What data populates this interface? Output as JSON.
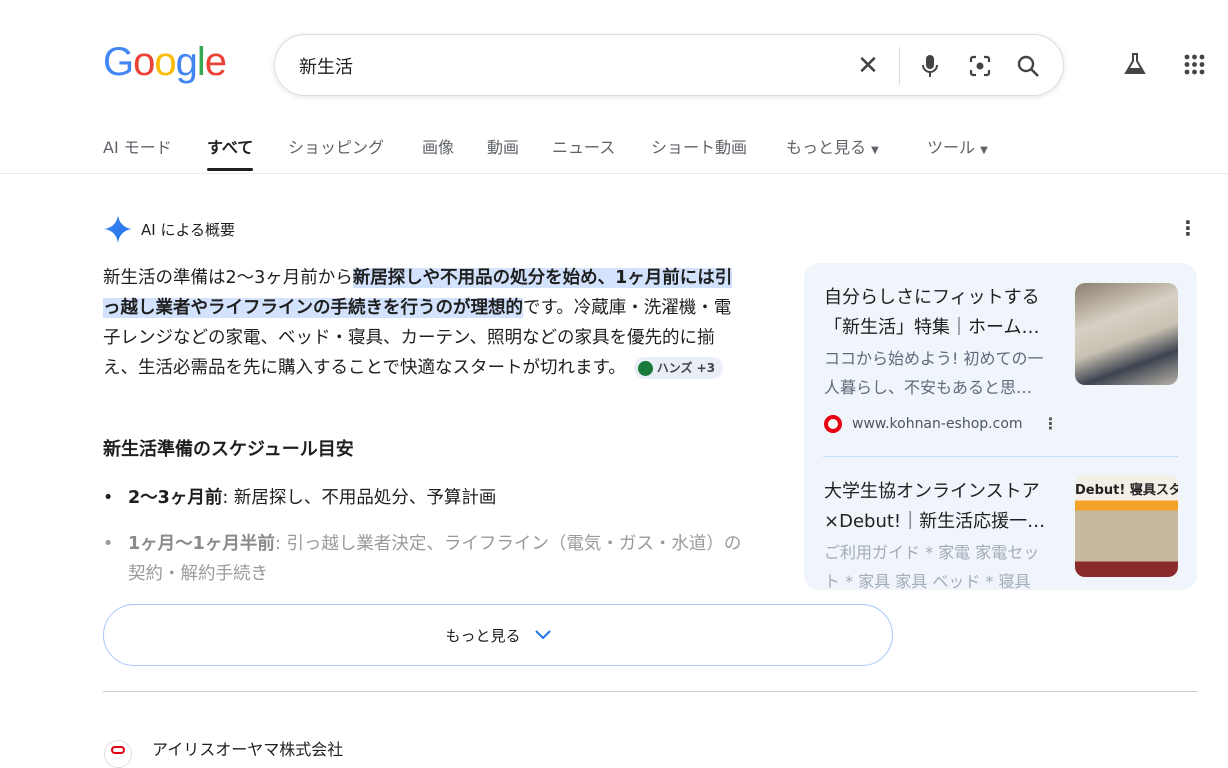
{
  "logo": "Google",
  "search": {
    "query": "新生活"
  },
  "tabs": [
    "AI モード",
    "すべて",
    "ショッピング",
    "画像",
    "動画",
    "ニュース",
    "ショート動画",
    "もっと見る",
    "ツール"
  ],
  "ai": {
    "title": "AI による概要",
    "p1": "新生活の準備は2〜3ヶ月前から",
    "p_hl": "新居探しや不用品の処分を始め、1ヶ月前には引っ越し業者やライフラインの手続きを行うのが理想的",
    "p2": "です。冷蔵庫・洗濯機・電子レンジなどの家電、ベッド・寝具、カーテン、照明などの家具を優先的に揃え、生活必需品を先に購入することで快適なスタートが切れます。",
    "chip": "ハンズ +3",
    "heading": "新生活準備のスケジュール目安",
    "bullets": [
      {
        "b": "2〜3ヶ月前",
        "t": ": 新居探し、不用品処分、予算計画"
      },
      {
        "b": "1ヶ月〜1ヶ月半前",
        "t": ": 引っ越し業者決定、ライフライン（電気・ガス・水道）の契約・解約手続き"
      }
    ],
    "more": "もっと見る"
  },
  "sources": [
    {
      "title": "自分らしさにフィットする「新生活」特集｜ホーム…",
      "desc": "ココから始めよう! 初めての一人暮らし、不安もあると思…",
      "site": "www.kohnan-eshop.com"
    },
    {
      "title": "大学生協オンラインストア×Debut!｜新生活応援一…",
      "desc": "ご利用ガイド * 家電 家電セット * 家具 家具 ベッド * 寝具 …",
      "img_text": "Debut! 寝具スタイ"
    }
  ],
  "result": {
    "title": "アイリスオーヤマ株式会社"
  }
}
